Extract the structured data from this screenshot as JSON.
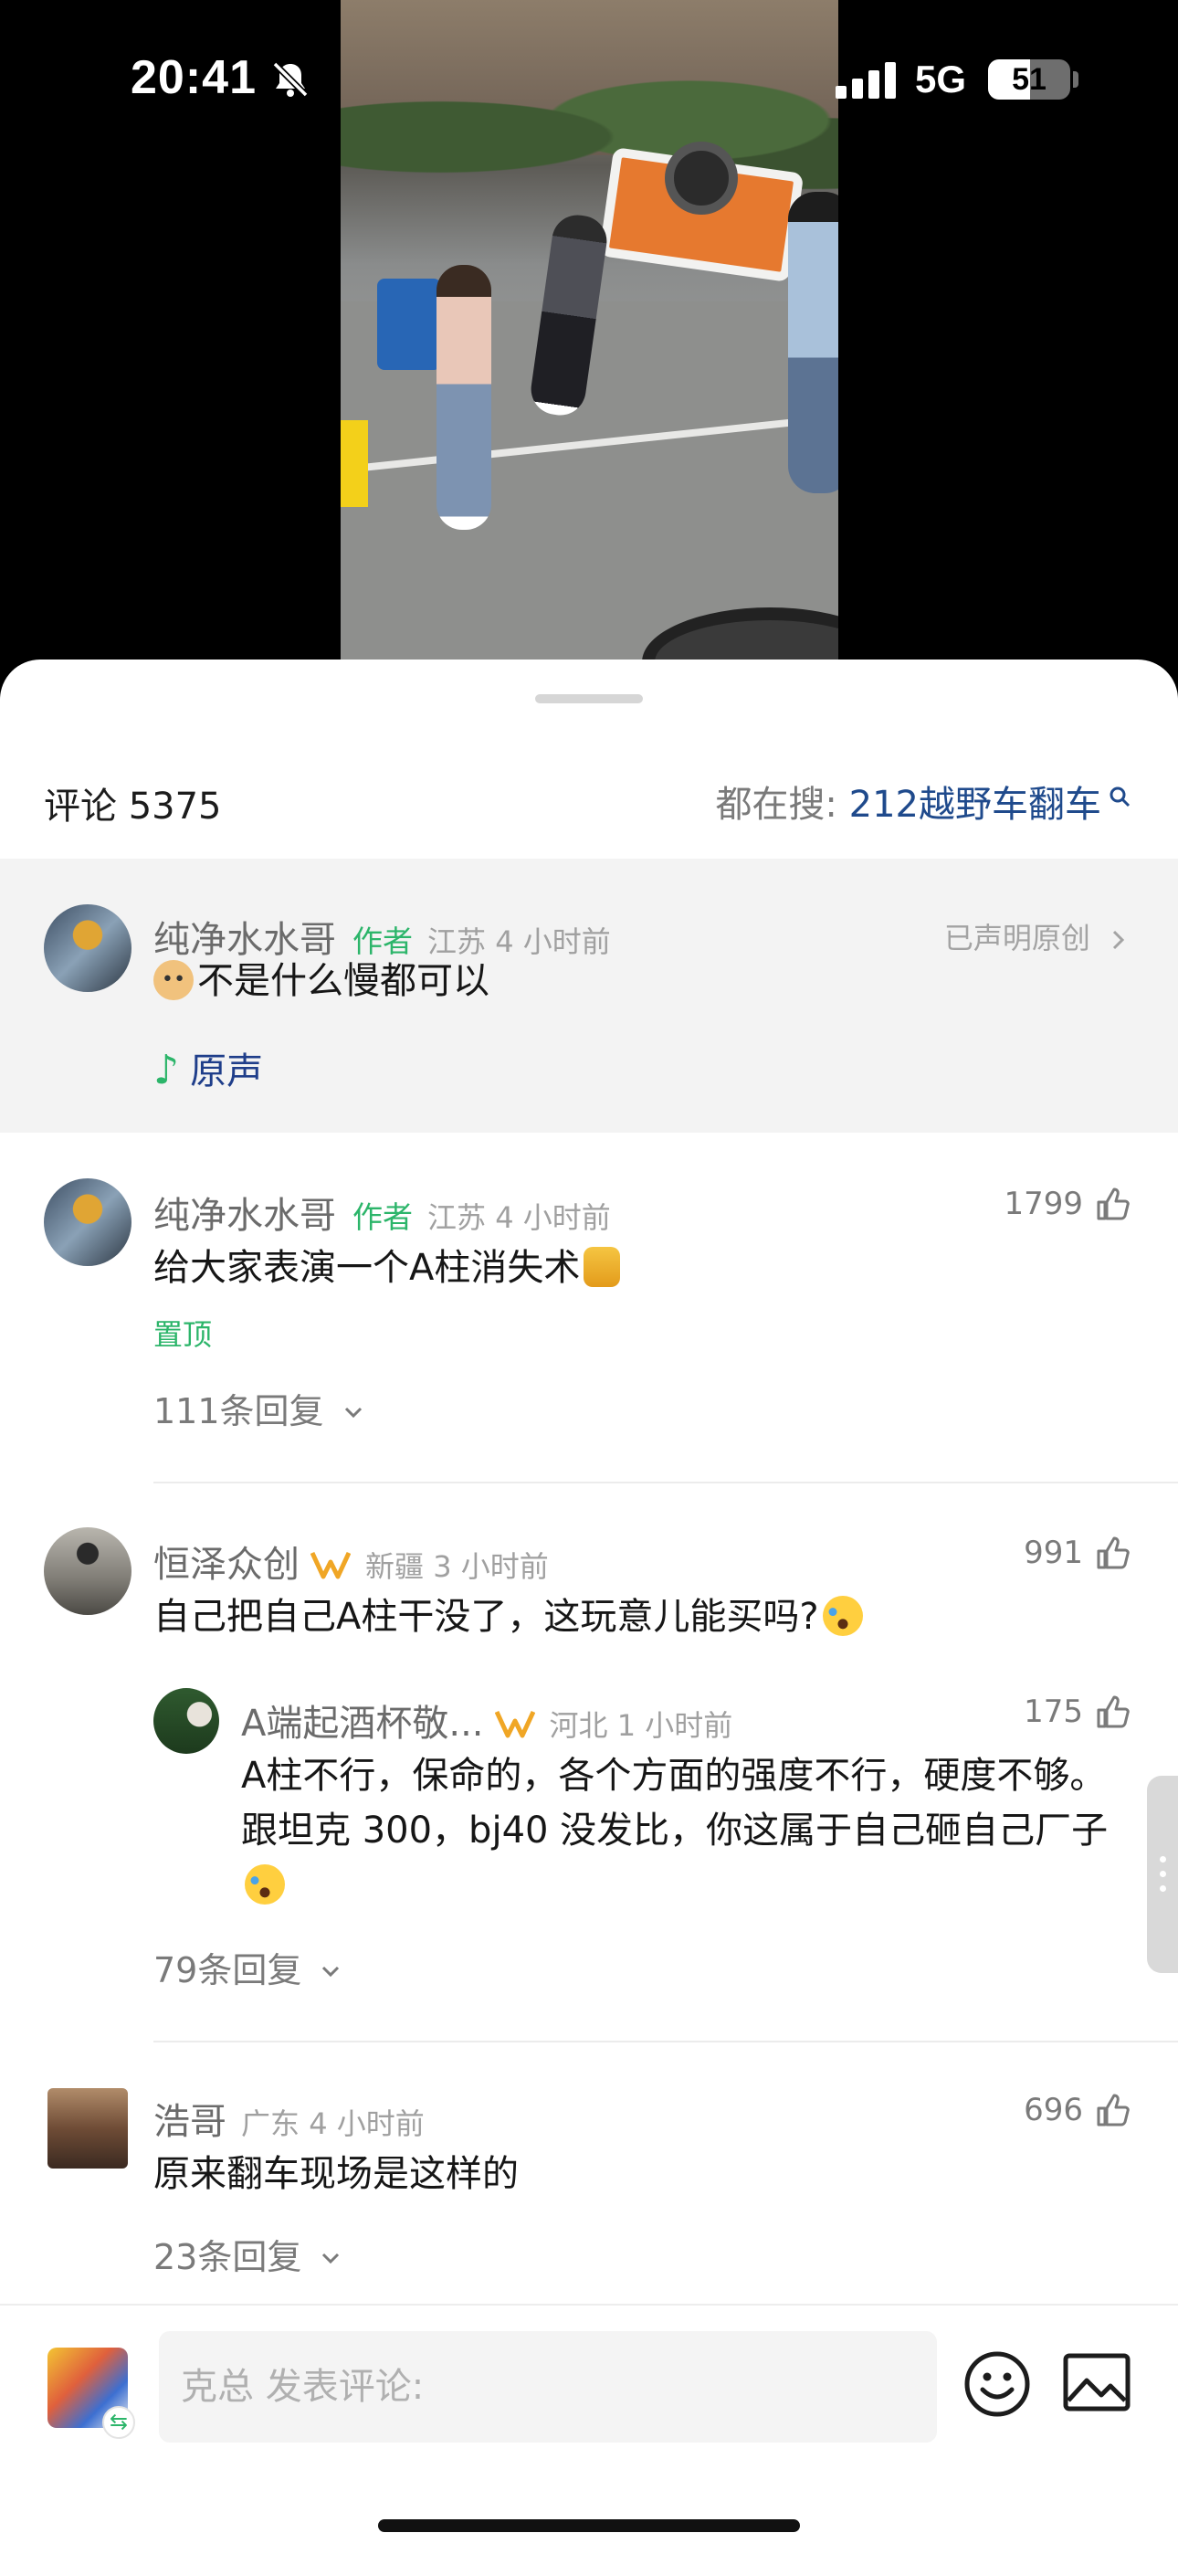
{
  "status_bar": {
    "time": "20:41",
    "network": "5G",
    "battery_level": "51",
    "battery_fraction": 0.51,
    "silent": true
  },
  "sheet": {
    "title": "评论 5375",
    "search_prefix": "都在搜: ",
    "search_keyword": "212越野车翻车"
  },
  "pinned_post": {
    "user": "纯净水水哥",
    "badge": "作者",
    "location": "江苏",
    "time": "4 小时前",
    "declared": "已声明原创",
    "text": "不是什么慢都可以",
    "sound_label": "原声"
  },
  "comments": [
    {
      "user": "纯净水水哥",
      "badge": "作者",
      "location": "江苏",
      "time": "4 小时前",
      "likes": "1799",
      "text": "给大家表演一个A柱消失术",
      "pin_label": "置顶",
      "replies": "111条回复"
    },
    {
      "user": "恒泽众创",
      "location": "新疆",
      "time": "3 小时前",
      "likes": "991",
      "text": "自己把自己A柱干没了，这玩意儿能买吗?",
      "reply": {
        "user": "A端起酒杯敬...",
        "location": "河北",
        "time": "1 小时前",
        "likes": "175",
        "text": "A柱不行，保命的，各个方面的强度不行，硬度不够。跟坦克 300，bj40 没发比，你这属于自己砸自己厂子"
      },
      "replies": "79条回复"
    },
    {
      "user": "浩哥",
      "location": "广东",
      "time": "4 小时前",
      "likes": "696",
      "text": "原来翻车现场是这样的",
      "replies": "23条回复"
    }
  ],
  "composer": {
    "placeholder": "克总 发表评论:"
  },
  "colors": {
    "author_badge": "#2cb56a",
    "link_blue": "#1f4a8c",
    "pinned_bg": "#f3f3f3"
  },
  "icons": [
    "bell-slash-icon",
    "signal-icon",
    "search-icon",
    "chevron-right-icon",
    "thumb-up-icon",
    "chevron-down-icon",
    "vip-badge-icon",
    "music-note-icon",
    "emoji-icon",
    "image-icon",
    "swap-icon"
  ]
}
